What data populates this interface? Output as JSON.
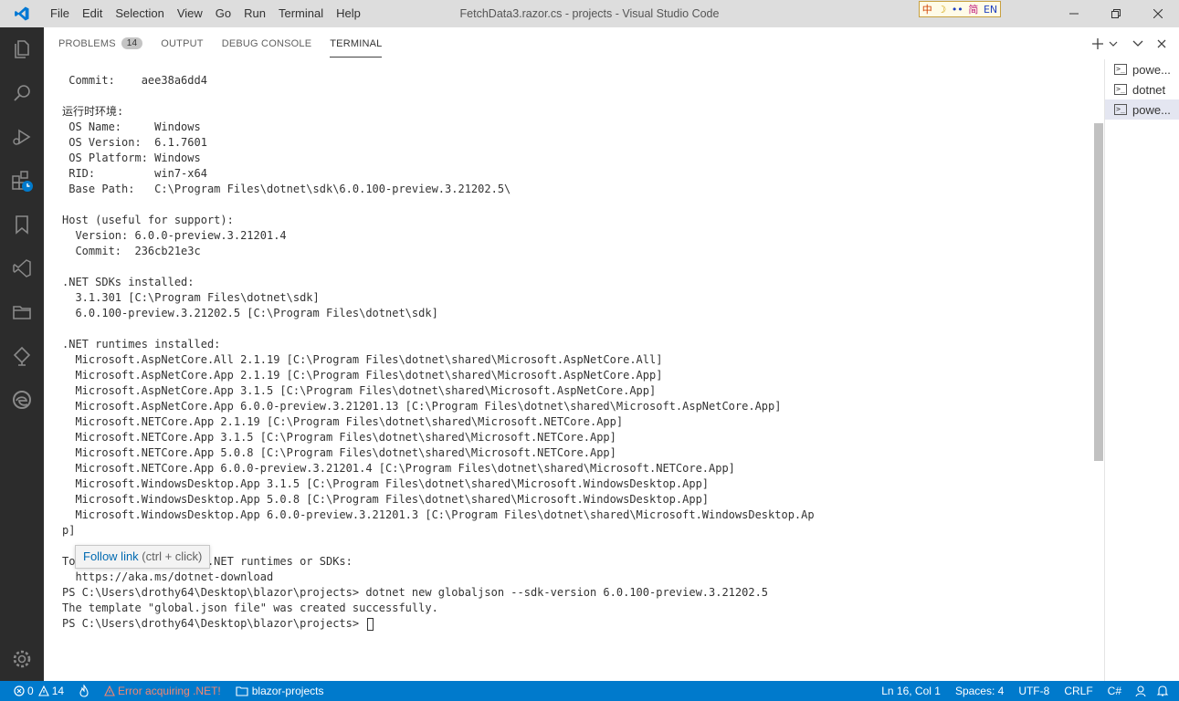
{
  "titlebar": {
    "menu": [
      "File",
      "Edit",
      "Selection",
      "View",
      "Go",
      "Run",
      "Terminal",
      "Help"
    ],
    "title": "FetchData3.razor.cs - projects - Visual Studio Code",
    "ime": {
      "a": "中",
      "b": "☽",
      "c": "••",
      "d": "简",
      "e": "EN"
    }
  },
  "panel": {
    "tabs": {
      "problems": "PROBLEMS",
      "problems_count": "14",
      "output": "OUTPUT",
      "debug_console": "DEBUG CONSOLE",
      "terminal": "TERMINAL"
    }
  },
  "terminal": {
    "lines": [
      " Commit:    aee38a6dd4",
      "",
      "运行时环境:",
      " OS Name:     Windows",
      " OS Version:  6.1.7601",
      " OS Platform: Windows",
      " RID:         win7-x64",
      " Base Path:   C:\\Program Files\\dotnet\\sdk\\6.0.100-preview.3.21202.5\\",
      "",
      "Host (useful for support):",
      "  Version: 6.0.0-preview.3.21201.4",
      "  Commit:  236cb21e3c",
      "",
      ".NET SDKs installed:",
      "  3.1.301 [C:\\Program Files\\dotnet\\sdk]",
      "  6.0.100-preview.3.21202.5 [C:\\Program Files\\dotnet\\sdk]",
      "",
      ".NET runtimes installed:",
      "  Microsoft.AspNetCore.All 2.1.19 [C:\\Program Files\\dotnet\\shared\\Microsoft.AspNetCore.All]",
      "  Microsoft.AspNetCore.App 2.1.19 [C:\\Program Files\\dotnet\\shared\\Microsoft.AspNetCore.App]",
      "  Microsoft.AspNetCore.App 3.1.5 [C:\\Program Files\\dotnet\\shared\\Microsoft.AspNetCore.App]",
      "  Microsoft.AspNetCore.App 6.0.0-preview.3.21201.13 [C:\\Program Files\\dotnet\\shared\\Microsoft.AspNetCore.App]",
      "  Microsoft.NETCore.App 2.1.19 [C:\\Program Files\\dotnet\\shared\\Microsoft.NETCore.App]",
      "  Microsoft.NETCore.App 3.1.5 [C:\\Program Files\\dotnet\\shared\\Microsoft.NETCore.App]",
      "  Microsoft.NETCore.App 5.0.8 [C:\\Program Files\\dotnet\\shared\\Microsoft.NETCore.App]",
      "  Microsoft.NETCore.App 6.0.0-preview.3.21201.4 [C:\\Program Files\\dotnet\\shared\\Microsoft.NETCore.App]",
      "  Microsoft.WindowsDesktop.App 3.1.5 [C:\\Program Files\\dotnet\\shared\\Microsoft.WindowsDesktop.App]",
      "  Microsoft.WindowsDesktop.App 5.0.8 [C:\\Program Files\\dotnet\\shared\\Microsoft.WindowsDesktop.App]",
      "  Microsoft.WindowsDesktop.App 6.0.0-preview.3.21201.3 [C:\\Program Files\\dotnet\\shared\\Microsoft.WindowsDesktop.Ap",
      "p]",
      "",
      "To install additional .NET runtimes or SDKs:"
    ],
    "link": "  https://aka.ms/dotnet-download",
    "after_link": [
      "PS C:\\Users\\drothy64\\Desktop\\blazor\\projects> dotnet new globaljson --sdk-version 6.0.100-preview.3.21202.5",
      "The template \"global.json file\" was created successfully."
    ],
    "prompt": "PS C:\\Users\\drothy64\\Desktop\\blazor\\projects> ",
    "tooltip_link": "Follow link",
    "tooltip_hint": " (ctrl + click)"
  },
  "terminal_list": [
    {
      "label": "powe...",
      "icon": "powershell-icon"
    },
    {
      "label": "dotnet",
      "icon": "powershell-icon"
    },
    {
      "label": "powe...",
      "icon": "powershell-icon"
    }
  ],
  "statusbar": {
    "errors": "0",
    "warnings": "14",
    "dotnet_error": "Error acquiring .NET!",
    "folder": "blazor-projects",
    "position": "Ln 16, Col 1",
    "spaces": "Spaces: 4",
    "encoding": "UTF-8",
    "eol": "CRLF",
    "language": "C#"
  },
  "colors": {
    "statusbar": "#007acc",
    "activitybar": "#2c2c2c",
    "titlebar": "#dddddd",
    "link": "#006ab1",
    "error": "#f48771"
  }
}
